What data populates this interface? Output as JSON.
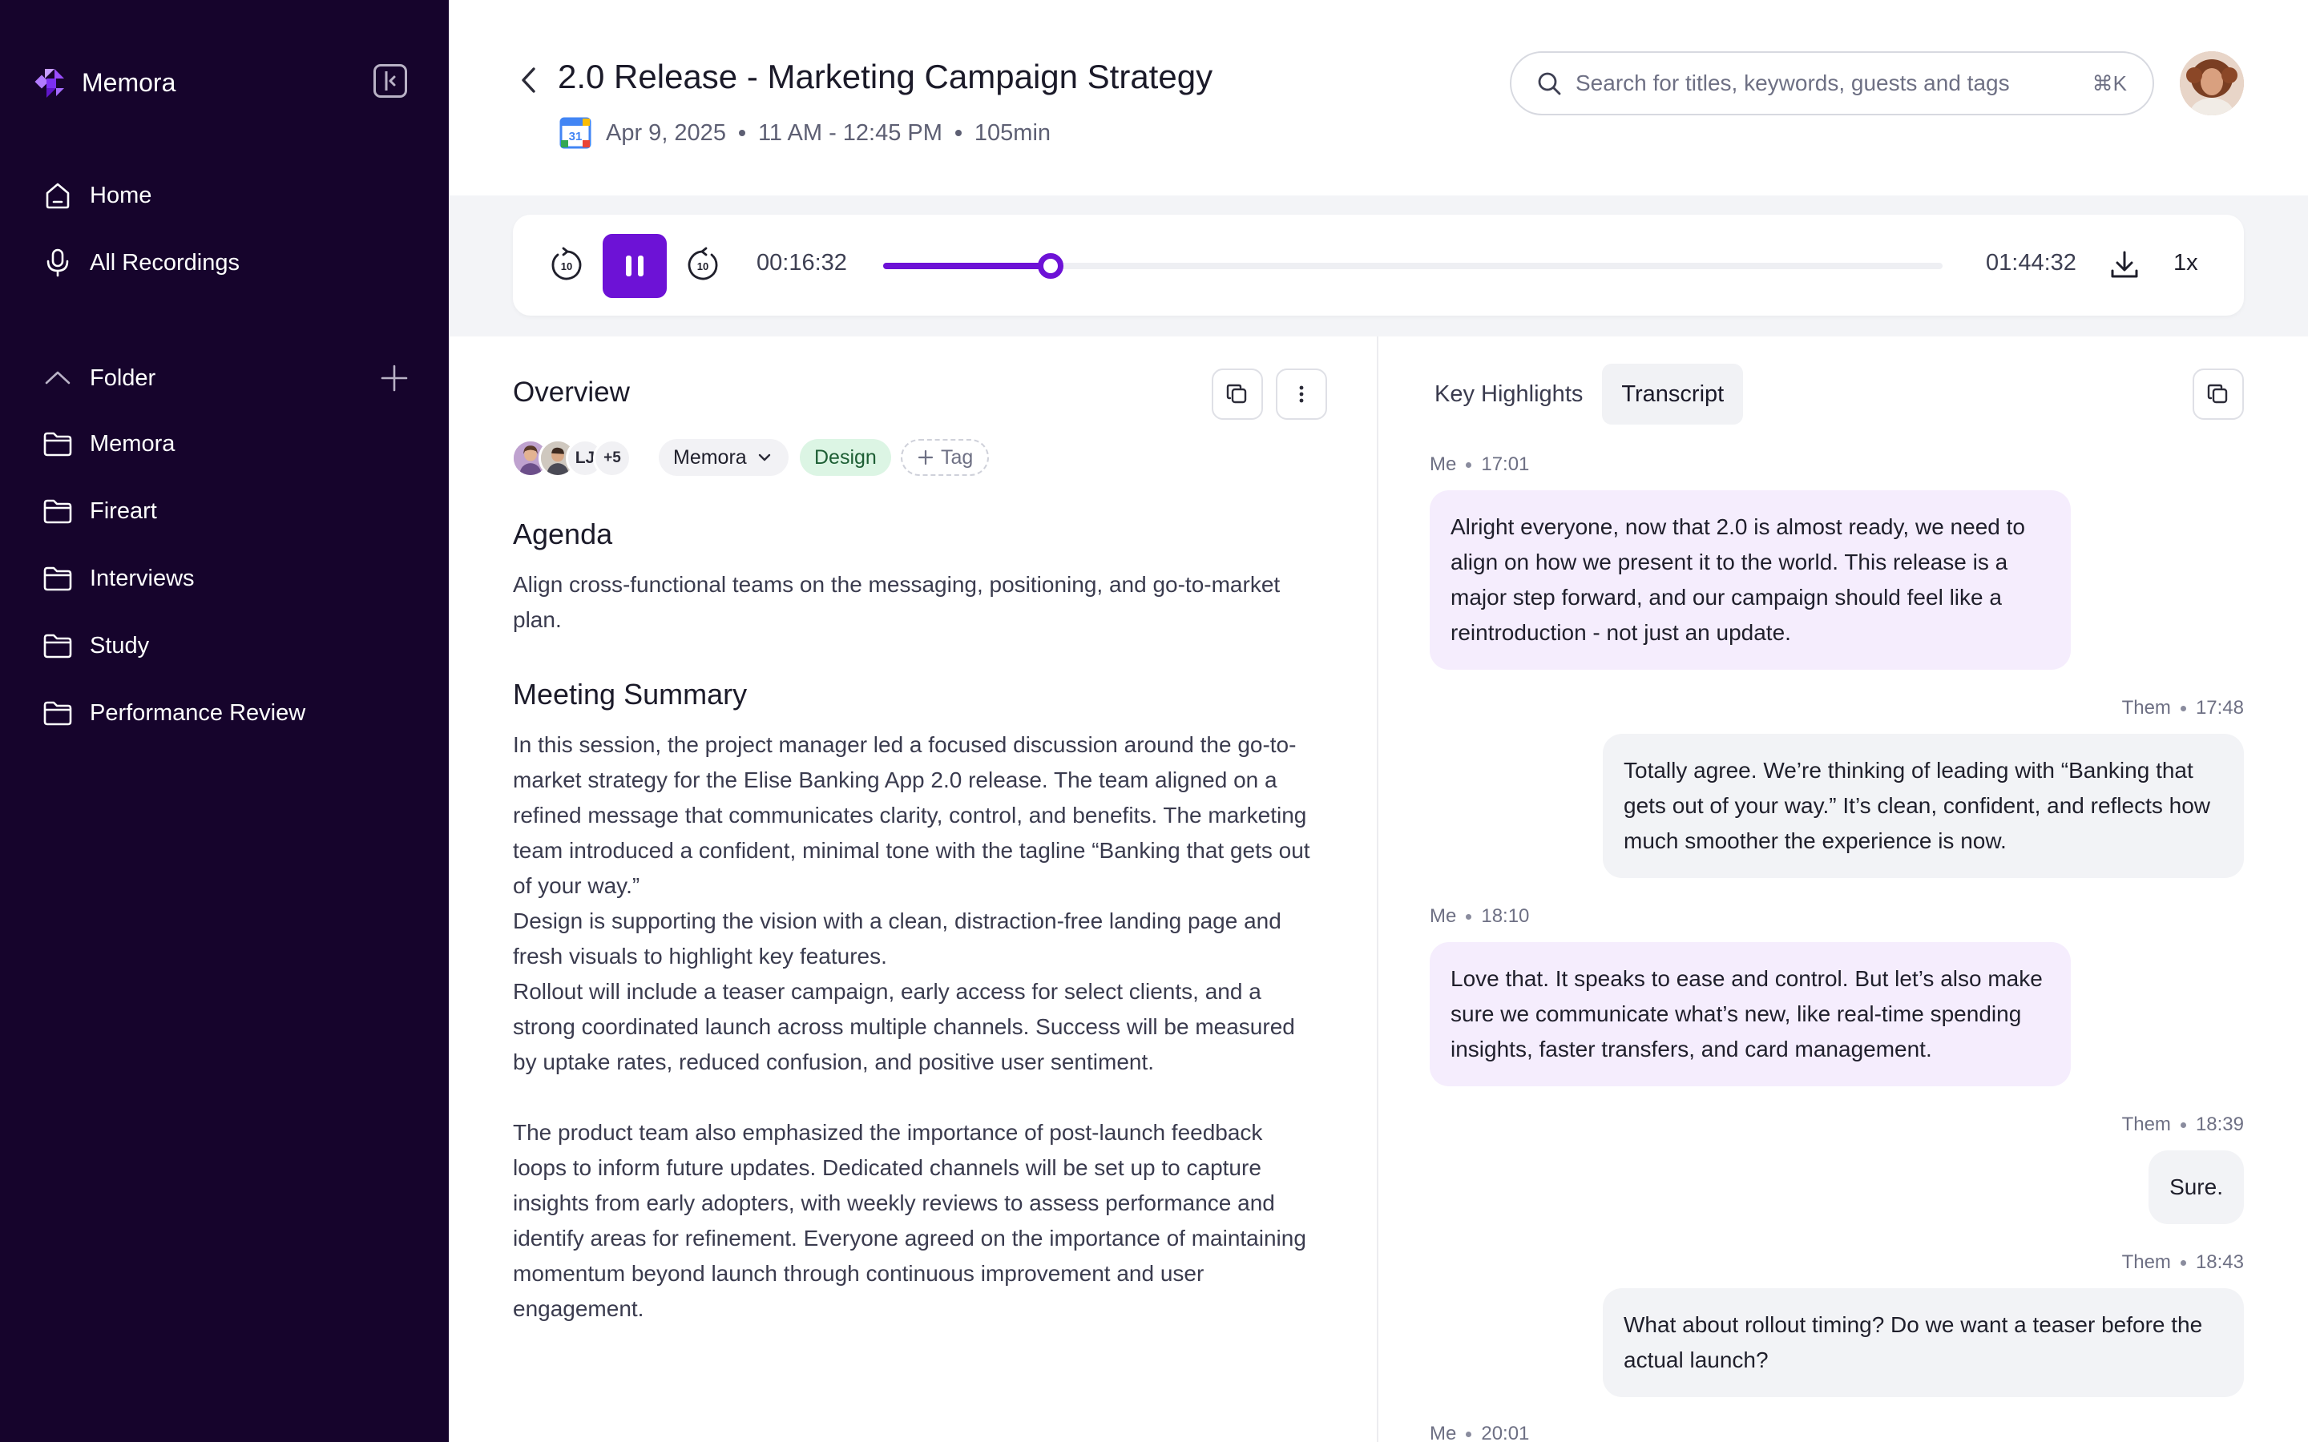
{
  "sidebar": {
    "brand": "Memora",
    "nav": [
      {
        "label": "Home",
        "icon": "home-icon"
      },
      {
        "label": "All Recordings",
        "icon": "microphone-icon"
      }
    ],
    "folder_header": "Folder",
    "folders": [
      "Memora",
      "Fireart",
      "Interviews",
      "Study",
      "Performance Review"
    ]
  },
  "header": {
    "title": "2.0 Release - Marketing Campaign Strategy",
    "date": "Apr 9, 2025",
    "time_range": "11 AM - 12:45 PM",
    "duration": "105min",
    "calendar_day": "31",
    "search_placeholder": "Search for titles, keywords, guests and tags",
    "search_shortcut": "⌘K"
  },
  "player": {
    "current_time": "00:16:32",
    "total_time": "01:44:32",
    "progress_fraction": 0.158,
    "speed": "1x",
    "skip_seconds": "10",
    "accent": "#6d12d6"
  },
  "overview": {
    "title": "Overview",
    "participants": {
      "initials": "LJ",
      "more": "+5"
    },
    "folder_chip": "Memora",
    "tags": [
      "Design"
    ],
    "add_tag": "Tag",
    "agenda_heading": "Agenda",
    "agenda_text": "Align cross-functional teams on the messaging, positioning, and go-to-market plan.",
    "summary_heading": "Meeting Summary",
    "summary_paragraphs": [
      "In this session, the project manager led a focused discussion around the go-to-market strategy for the Elise Banking App 2.0 release. The team aligned on a refined message that communicates clarity, control, and benefits. The marketing team introduced a confident, minimal tone with the tagline “Banking that gets out of your way.”",
      "Design is supporting the vision with a clean, distraction-free landing page and fresh visuals to highlight key features.",
      "Rollout will include a teaser campaign, early access for select clients, and a strong coordinated launch across multiple channels. Success will be measured by uptake rates, reduced confusion, and positive user sentiment.",
      "The product team also emphasized the importance of post-launch feedback loops to inform future updates. Dedicated channels will be set up to capture insights from early adopters, with weekly reviews to assess performance and identify areas for refinement. Everyone agreed on the importance of maintaining momentum beyond launch through continuous improvement and user engagement."
    ]
  },
  "transcript": {
    "tabs": [
      "Key Highlights",
      "Transcript"
    ],
    "active_tab": "Transcript",
    "messages": [
      {
        "speaker": "Me",
        "time": "17:01",
        "text": "Alright everyone, now that 2.0 is almost ready, we need to align on how we present it to the world. This release is a major step forward, and our campaign should feel like a reintroduction - not just an update."
      },
      {
        "speaker": "Them",
        "time": "17:48",
        "text": "Totally agree. We’re thinking of leading with “Banking that gets out of your way.” It’s clean, confident, and reflects how much smoother the experience is now."
      },
      {
        "speaker": "Me",
        "time": "18:10",
        "text": "Love that. It speaks to ease and control. But let’s also make sure we communicate what’s new, like real-time spending insights, faster transfers, and card management."
      },
      {
        "speaker": "Them",
        "time": "18:39",
        "text": "Sure."
      },
      {
        "speaker": "Them",
        "time": "18:43",
        "text": "What about rollout timing? Do we want a teaser before the actual launch?"
      },
      {
        "speaker": "Me",
        "time": "20:01",
        "text": ""
      }
    ]
  }
}
